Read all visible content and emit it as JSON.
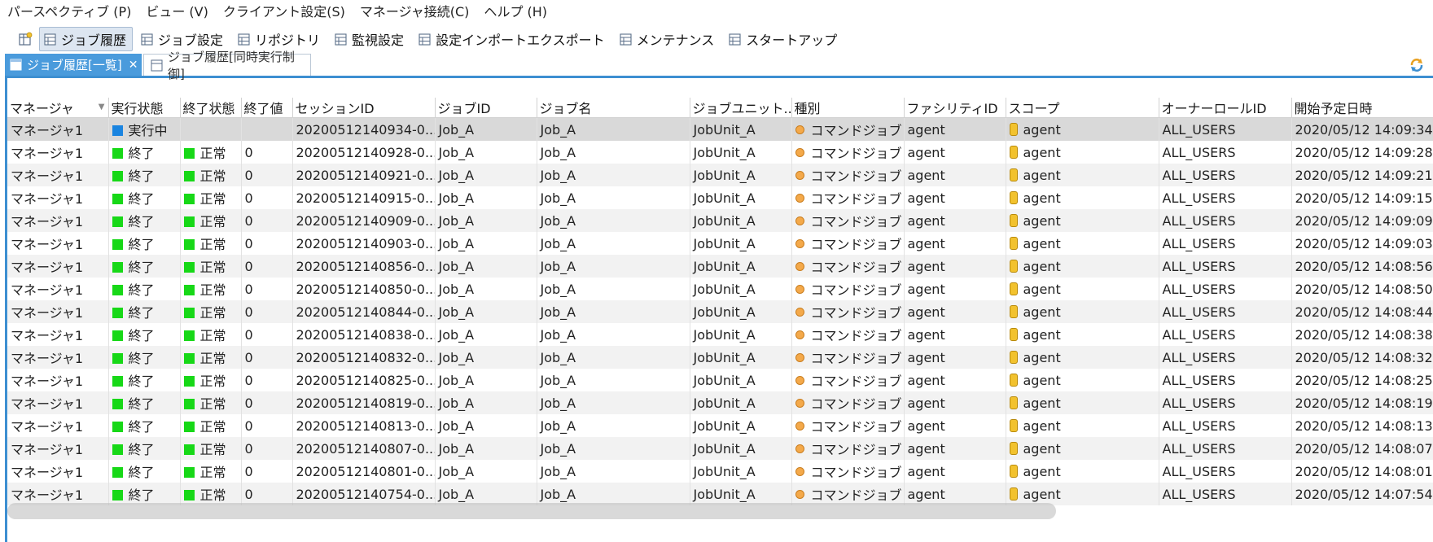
{
  "menubar": [
    {
      "label": "パースペクティブ (P)"
    },
    {
      "label": "ビュー (V)"
    },
    {
      "label": "クライアント設定(S)"
    },
    {
      "label": "マネージャ接続(C)"
    },
    {
      "label": "ヘルプ (H)"
    }
  ],
  "toolbar": [
    {
      "label": "ジョブ履歴",
      "active": true
    },
    {
      "label": "ジョブ設定",
      "active": false
    },
    {
      "label": "リポジトリ",
      "active": false
    },
    {
      "label": "監視設定",
      "active": false
    },
    {
      "label": "設定インポートエクスポート",
      "active": false
    },
    {
      "label": "メンテナンス",
      "active": false
    },
    {
      "label": "スタートアップ",
      "active": false
    }
  ],
  "tabs": [
    {
      "label": "ジョブ履歴[一覧]",
      "close": "✕"
    },
    {
      "label": "ジョブ履歴[同時実行制御]"
    }
  ],
  "table": {
    "columns": [
      "マネージャ",
      "実行状態",
      "終了状態",
      "終了値",
      "セッションID",
      "ジョブID",
      "ジョブ名",
      "ジョブユニット...",
      "種別",
      "ファシリティID",
      "スコープ",
      "オーナーロールID",
      "開始予定日時"
    ],
    "rows": [
      {
        "manager": "マネージャ1",
        "run_state": "実行中",
        "run_color": "blue",
        "end_state": "",
        "end_value": "",
        "session": "20200512140934-0...",
        "job_id": "Job_A",
        "job_name": "Job_A",
        "unit": "JobUnit_A",
        "type": "コマンドジョブ",
        "facility": "agent",
        "scope": "agent",
        "owner": "ALL_USERS",
        "start": "2020/05/12 14:09:34"
      },
      {
        "manager": "マネージャ1",
        "run_state": "終了",
        "run_color": "green",
        "end_state": "正常",
        "end_value": "0",
        "session": "20200512140928-0...",
        "job_id": "Job_A",
        "job_name": "Job_A",
        "unit": "JobUnit_A",
        "type": "コマンドジョブ",
        "facility": "agent",
        "scope": "agent",
        "owner": "ALL_USERS",
        "start": "2020/05/12 14:09:28"
      },
      {
        "manager": "マネージャ1",
        "run_state": "終了",
        "run_color": "green",
        "end_state": "正常",
        "end_value": "0",
        "session": "20200512140921-0...",
        "job_id": "Job_A",
        "job_name": "Job_A",
        "unit": "JobUnit_A",
        "type": "コマンドジョブ",
        "facility": "agent",
        "scope": "agent",
        "owner": "ALL_USERS",
        "start": "2020/05/12 14:09:21"
      },
      {
        "manager": "マネージャ1",
        "run_state": "終了",
        "run_color": "green",
        "end_state": "正常",
        "end_value": "0",
        "session": "20200512140915-0...",
        "job_id": "Job_A",
        "job_name": "Job_A",
        "unit": "JobUnit_A",
        "type": "コマンドジョブ",
        "facility": "agent",
        "scope": "agent",
        "owner": "ALL_USERS",
        "start": "2020/05/12 14:09:15"
      },
      {
        "manager": "マネージャ1",
        "run_state": "終了",
        "run_color": "green",
        "end_state": "正常",
        "end_value": "0",
        "session": "20200512140909-0...",
        "job_id": "Job_A",
        "job_name": "Job_A",
        "unit": "JobUnit_A",
        "type": "コマンドジョブ",
        "facility": "agent",
        "scope": "agent",
        "owner": "ALL_USERS",
        "start": "2020/05/12 14:09:09"
      },
      {
        "manager": "マネージャ1",
        "run_state": "終了",
        "run_color": "green",
        "end_state": "正常",
        "end_value": "0",
        "session": "20200512140903-0...",
        "job_id": "Job_A",
        "job_name": "Job_A",
        "unit": "JobUnit_A",
        "type": "コマンドジョブ",
        "facility": "agent",
        "scope": "agent",
        "owner": "ALL_USERS",
        "start": "2020/05/12 14:09:03"
      },
      {
        "manager": "マネージャ1",
        "run_state": "終了",
        "run_color": "green",
        "end_state": "正常",
        "end_value": "0",
        "session": "20200512140856-0...",
        "job_id": "Job_A",
        "job_name": "Job_A",
        "unit": "JobUnit_A",
        "type": "コマンドジョブ",
        "facility": "agent",
        "scope": "agent",
        "owner": "ALL_USERS",
        "start": "2020/05/12 14:08:56"
      },
      {
        "manager": "マネージャ1",
        "run_state": "終了",
        "run_color": "green",
        "end_state": "正常",
        "end_value": "0",
        "session": "20200512140850-0...",
        "job_id": "Job_A",
        "job_name": "Job_A",
        "unit": "JobUnit_A",
        "type": "コマンドジョブ",
        "facility": "agent",
        "scope": "agent",
        "owner": "ALL_USERS",
        "start": "2020/05/12 14:08:50"
      },
      {
        "manager": "マネージャ1",
        "run_state": "終了",
        "run_color": "green",
        "end_state": "正常",
        "end_value": "0",
        "session": "20200512140844-0...",
        "job_id": "Job_A",
        "job_name": "Job_A",
        "unit": "JobUnit_A",
        "type": "コマンドジョブ",
        "facility": "agent",
        "scope": "agent",
        "owner": "ALL_USERS",
        "start": "2020/05/12 14:08:44"
      },
      {
        "manager": "マネージャ1",
        "run_state": "終了",
        "run_color": "green",
        "end_state": "正常",
        "end_value": "0",
        "session": "20200512140838-0...",
        "job_id": "Job_A",
        "job_name": "Job_A",
        "unit": "JobUnit_A",
        "type": "コマンドジョブ",
        "facility": "agent",
        "scope": "agent",
        "owner": "ALL_USERS",
        "start": "2020/05/12 14:08:38"
      },
      {
        "manager": "マネージャ1",
        "run_state": "終了",
        "run_color": "green",
        "end_state": "正常",
        "end_value": "0",
        "session": "20200512140832-0...",
        "job_id": "Job_A",
        "job_name": "Job_A",
        "unit": "JobUnit_A",
        "type": "コマンドジョブ",
        "facility": "agent",
        "scope": "agent",
        "owner": "ALL_USERS",
        "start": "2020/05/12 14:08:32"
      },
      {
        "manager": "マネージャ1",
        "run_state": "終了",
        "run_color": "green",
        "end_state": "正常",
        "end_value": "0",
        "session": "20200512140825-0...",
        "job_id": "Job_A",
        "job_name": "Job_A",
        "unit": "JobUnit_A",
        "type": "コマンドジョブ",
        "facility": "agent",
        "scope": "agent",
        "owner": "ALL_USERS",
        "start": "2020/05/12 14:08:25"
      },
      {
        "manager": "マネージャ1",
        "run_state": "終了",
        "run_color": "green",
        "end_state": "正常",
        "end_value": "0",
        "session": "20200512140819-0...",
        "job_id": "Job_A",
        "job_name": "Job_A",
        "unit": "JobUnit_A",
        "type": "コマンドジョブ",
        "facility": "agent",
        "scope": "agent",
        "owner": "ALL_USERS",
        "start": "2020/05/12 14:08:19"
      },
      {
        "manager": "マネージャ1",
        "run_state": "終了",
        "run_color": "green",
        "end_state": "正常",
        "end_value": "0",
        "session": "20200512140813-0...",
        "job_id": "Job_A",
        "job_name": "Job_A",
        "unit": "JobUnit_A",
        "type": "コマンドジョブ",
        "facility": "agent",
        "scope": "agent",
        "owner": "ALL_USERS",
        "start": "2020/05/12 14:08:13"
      },
      {
        "manager": "マネージャ1",
        "run_state": "終了",
        "run_color": "green",
        "end_state": "正常",
        "end_value": "0",
        "session": "20200512140807-0...",
        "job_id": "Job_A",
        "job_name": "Job_A",
        "unit": "JobUnit_A",
        "type": "コマンドジョブ",
        "facility": "agent",
        "scope": "agent",
        "owner": "ALL_USERS",
        "start": "2020/05/12 14:08:07"
      },
      {
        "manager": "マネージャ1",
        "run_state": "終了",
        "run_color": "green",
        "end_state": "正常",
        "end_value": "0",
        "session": "20200512140801-0...",
        "job_id": "Job_A",
        "job_name": "Job_A",
        "unit": "JobUnit_A",
        "type": "コマンドジョブ",
        "facility": "agent",
        "scope": "agent",
        "owner": "ALL_USERS",
        "start": "2020/05/12 14:08:01"
      },
      {
        "manager": "マネージャ1",
        "run_state": "終了",
        "run_color": "green",
        "end_state": "正常",
        "end_value": "0",
        "session": "20200512140754-0...",
        "job_id": "Job_A",
        "job_name": "Job_A",
        "unit": "JobUnit_A",
        "type": "コマンドジョブ",
        "facility": "agent",
        "scope": "agent",
        "owner": "ALL_USERS",
        "start": "2020/05/12 14:07:54"
      }
    ]
  },
  "colors": {
    "accent": "#3d8fd1",
    "status_green": "#17d817",
    "status_blue": "#1a84e0",
    "job_dot": "#f4a94a",
    "scope_icon": "#f2c22e"
  },
  "icons": {
    "view_icon": "table-view-icon",
    "refresh_icon": "refresh-icon",
    "scope_icon": "scope-icon",
    "job_type_icon": "command-job-icon"
  }
}
